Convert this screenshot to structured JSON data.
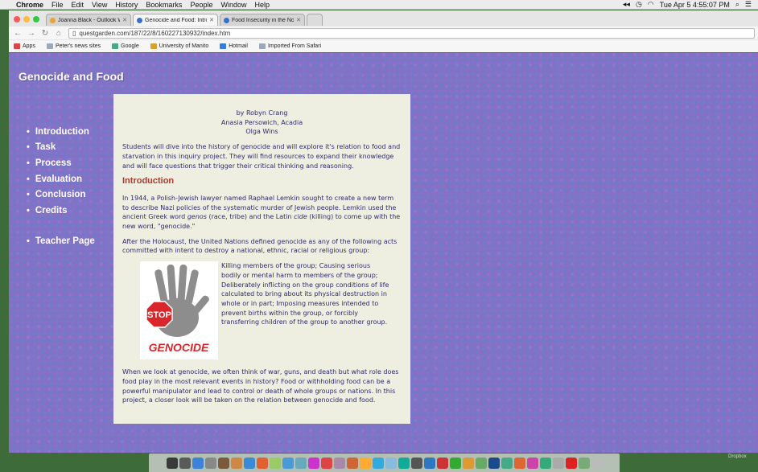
{
  "menubar": {
    "app": "Chrome",
    "items": [
      "File",
      "Edit",
      "View",
      "History",
      "Bookmarks",
      "People",
      "Window",
      "Help"
    ],
    "clock": "Tue Apr 5  4:55:07 PM"
  },
  "tabs": [
    {
      "label": "Joanna Black - Outlook We",
      "color": "#e8a33a"
    },
    {
      "label": "Genocide and Food: Introd",
      "color": "#3a6fc4",
      "active": true
    },
    {
      "label": "Food Insecurity in the Nort",
      "color": "#3a6fc4"
    }
  ],
  "address": {
    "url": "questgarden.com/187/22/8/160227130932/index.htm"
  },
  "bookmarks": [
    {
      "label": "Apps",
      "color": "#d44"
    },
    {
      "label": "Peter's news sites",
      "color": "#9ab"
    },
    {
      "label": "Google",
      "color": "#4a8"
    },
    {
      "label": "University of Manito",
      "color": "#d8a030"
    },
    {
      "label": "Hotmail",
      "color": "#3a7ad8"
    },
    {
      "label": "Imported From Safari",
      "color": "#9ab"
    }
  ],
  "site": {
    "title": "Genocide and Food",
    "nav": [
      "Introduction",
      "Task",
      "Process",
      "Evaluation",
      "Conclusion",
      "Credits"
    ],
    "teacher_link": "Teacher Page"
  },
  "content": {
    "authors": [
      "by Robyn Crang",
      "Anasia Persowich, Acadia",
      "Olga Wins"
    ],
    "intro_summary": "Students will dive into the history of genocide and will explore it's relation to food and starvation in this inquiry project. They will find resources to expand their knowledge and will face questions that trigger their critical thinking and reasoning.",
    "heading": "Introduction",
    "para1_a": "In 1944, a Polish-Jewish lawyer named Raphael Lemkin sought to create a new term to describe Nazi policies of the systematic murder of Jewish people. Lemkin used the ancient Greek word ",
    "para1_genos": "genos",
    "para1_b": " (race, tribe) and the Latin ",
    "para1_cide": "cide",
    "para1_c": " (killing) to come up with the new word, \"genocide.\"",
    "para2": "After the Holocaust, the United Nations defined genocide as any of the following acts committed with intent to destroy a national, ethnic, racial or religious group:",
    "acts": "Killing members of the group; Causing serious bodily or mental harm to members of the group; Deliberately inflicting on the group conditions of life calculated to bring about its physical destruction in whole or in part; Imposing measures intended to prevent births within the group, or forcibly transferring children of the group to another group.",
    "image": {
      "stop_text": "STOP",
      "caption": "GENOCIDE"
    },
    "para3": "When we look at genocide, we often think of war, guns, and death but what role does food play in the most relevant events in history? Food or withholding food can be a powerful manipulator and lead to control or death of whole groups or nations. In this project, a closer look will be taken on the relation between genocide and food."
  },
  "dock": {
    "label": "Dropbox",
    "icons": [
      "#3a3a3a",
      "#5a5a5a",
      "#3b82d8",
      "#888",
      "#7a5a3a",
      "#c84",
      "#3a8ad8",
      "#e06030",
      "#9c6",
      "#4a9ad8",
      "#6ab",
      "#c3c",
      "#d44",
      "#a8a",
      "#c63",
      "#fa3",
      "#3ad",
      "#8bd",
      "#1a9",
      "#555",
      "#2e78c2",
      "#c33",
      "#3a3",
      "#d93",
      "#6a6",
      "#1b4b8a",
      "#4a8",
      "#d63",
      "#c4a",
      "#3a7",
      "#aaa",
      "#d22",
      "#7a7",
      "#bbb"
    ]
  }
}
